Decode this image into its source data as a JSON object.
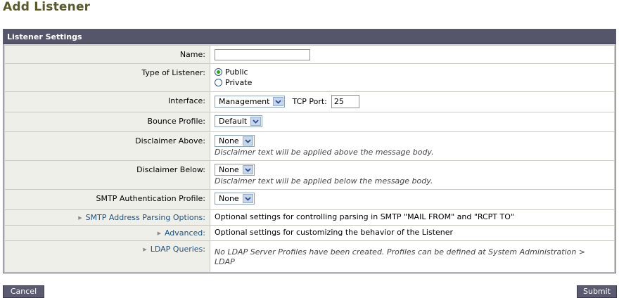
{
  "page": {
    "title": "Add Listener"
  },
  "panel": {
    "header": "Listener Settings"
  },
  "fields": {
    "name": {
      "label": "Name:",
      "value": ""
    },
    "type": {
      "label": "Type of Listener:",
      "options": [
        "Public",
        "Private"
      ],
      "selected": "Public"
    },
    "interface": {
      "label": "Interface:",
      "value": "Management",
      "tcp_label": "TCP Port:",
      "tcp_value": "25"
    },
    "bounce": {
      "label": "Bounce Profile:",
      "value": "Default"
    },
    "disclaimer_above": {
      "label": "Disclaimer Above:",
      "value": "None",
      "help": "Disclaimer text will be applied above the message body."
    },
    "disclaimer_below": {
      "label": "Disclaimer Below:",
      "value": "None",
      "help": "Disclaimer text will be applied below the message body."
    },
    "smtp_auth": {
      "label": "SMTP Authentication Profile:",
      "value": "None"
    },
    "smtp_parsing": {
      "label": "SMTP Address Parsing Options:",
      "text": "Optional settings for controlling parsing in SMTP \"MAIL FROM\" and \"RCPT TO\""
    },
    "advanced": {
      "label": "Advanced:",
      "text": "Optional settings for customizing the behavior of the Listener"
    },
    "ldap": {
      "label": "LDAP Queries:",
      "text": "No LDAP Server Profiles have been created. Profiles can be defined at System Administration > LDAP"
    }
  },
  "buttons": {
    "cancel": "Cancel",
    "submit": "Submit"
  },
  "colors": {
    "title": "#5a5a28",
    "header_bg": "#56566a",
    "label_bg": "#efefe9",
    "link": "#1f4f7a",
    "button_bg": "#5a5a70",
    "radio_on": "#27a327"
  },
  "icons": {
    "select_toggle": "chevron-down-icon",
    "expand": "triangle-right-icon"
  }
}
